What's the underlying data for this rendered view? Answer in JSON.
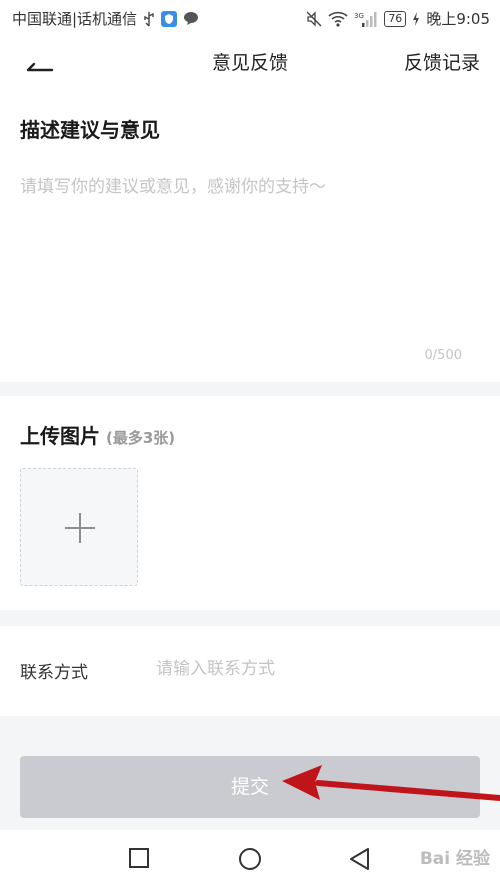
{
  "status_bar": {
    "carrier": "中国联通|话机通信",
    "battery": "76",
    "time": "晚上9:05",
    "network": "3G"
  },
  "header": {
    "title": "意见反馈",
    "records_link": "反馈记录"
  },
  "feedback": {
    "heading": "描述建议与意见",
    "placeholder": "请填写你的建议或意见，感谢你的支持～",
    "char_count": "0/500"
  },
  "upload": {
    "heading": "上传图片",
    "hint": "(最多3张)"
  },
  "contact": {
    "label": "联系方式",
    "placeholder": "请输入联系方式"
  },
  "submit": {
    "label": "提交"
  },
  "watermark": "Bai 经验",
  "colors": {
    "submit_disabled": "#c9cbd0",
    "separator": "#f4f5f7",
    "annotation_arrow": "#c0141b"
  }
}
